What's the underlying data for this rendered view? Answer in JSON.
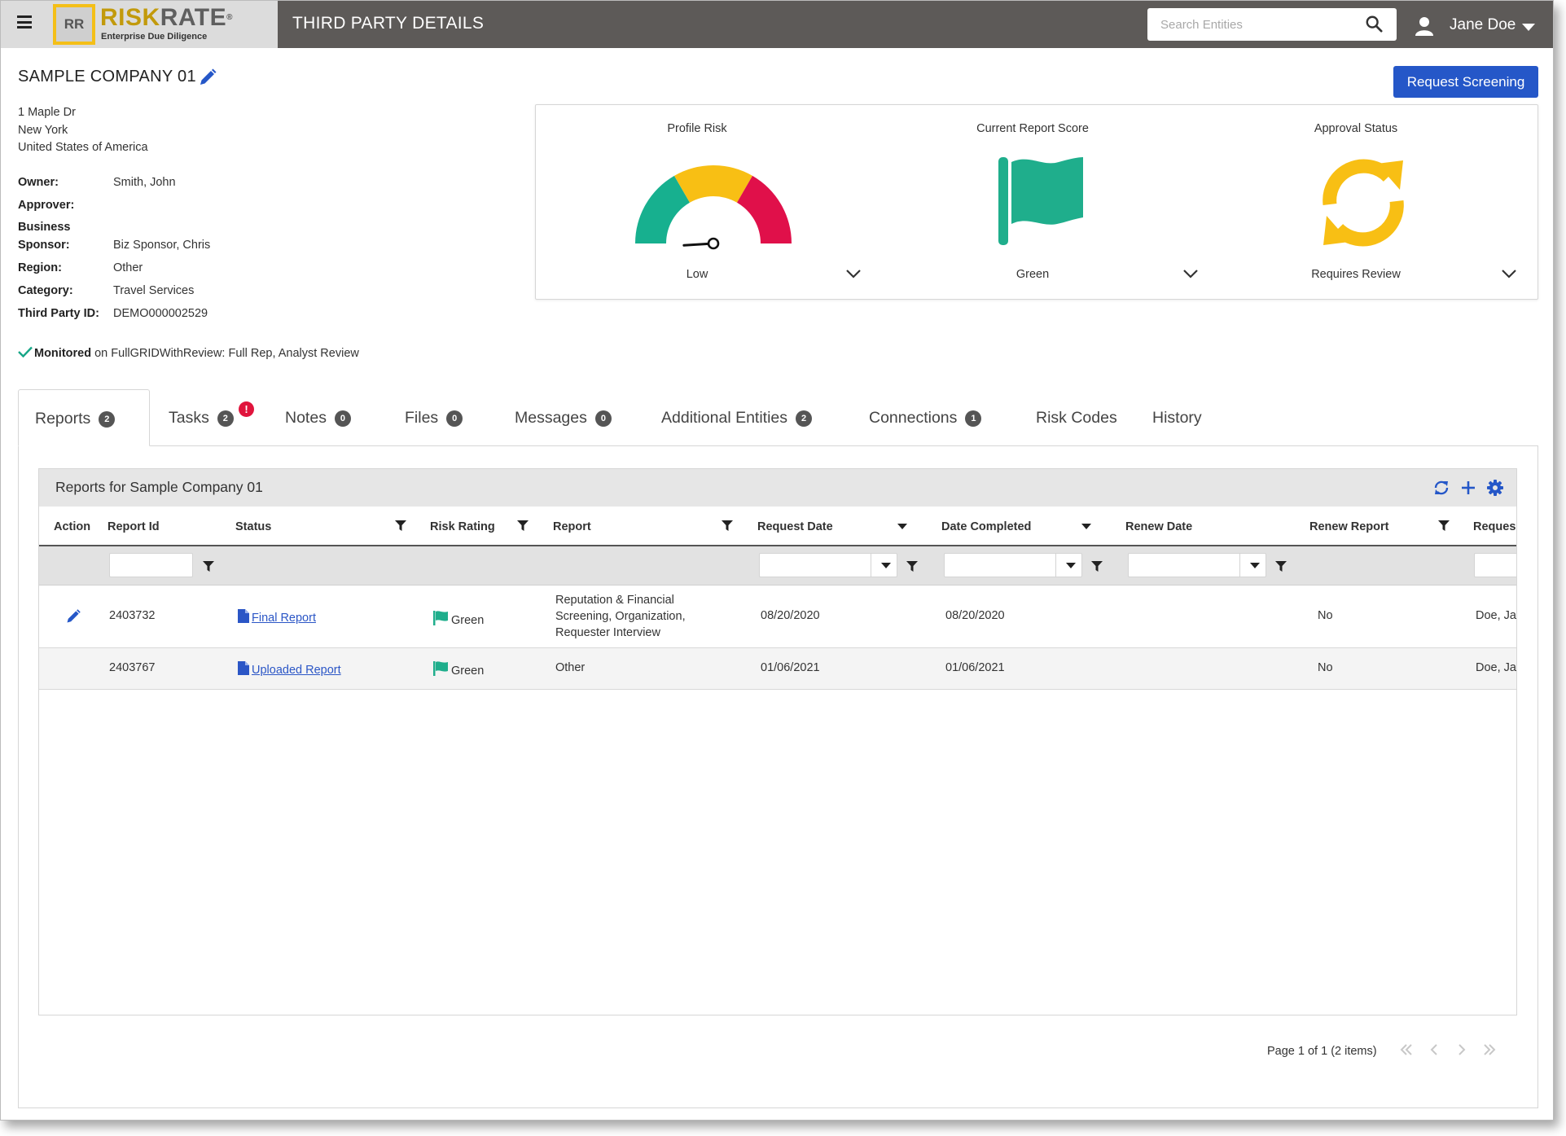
{
  "header": {
    "logo_box": "RR",
    "logo_risk": "RISK",
    "logo_rate": "RATE",
    "logo_reg": "®",
    "logo_tagline": "Enterprise Due Diligence",
    "page_title": "THIRD PARTY DETAILS",
    "search_placeholder": "Search Entities",
    "user_name": "Jane Doe"
  },
  "company": {
    "name": "SAMPLE COMPANY 01",
    "address_line1": "1 Maple Dr",
    "address_line2": "New York",
    "address_line3": "United States of America",
    "fields": {
      "owner_label": "Owner:",
      "owner_value": "Smith, John",
      "approver_label": "Approver:",
      "approver_value": "",
      "sponsor_label_1": "Business",
      "sponsor_label_2": "Sponsor:",
      "sponsor_value": "Biz Sponsor, Chris",
      "region_label": "Region:",
      "region_value": "Other",
      "category_label": "Category:",
      "category_value": "Travel Services",
      "tpid_label": "Third Party ID:",
      "tpid_value": "DEMO000002529"
    },
    "monitored_label": "Monitored",
    "monitored_text": "on FullGRIDWithReview: Full Rep, Analyst Review"
  },
  "request_button": "Request Screening",
  "scores": {
    "profile_risk": {
      "title": "Profile Risk",
      "value": "Low",
      "gauge_level": 0.1
    },
    "report_score": {
      "title": "Current Report Score",
      "value": "Green"
    },
    "approval": {
      "title": "Approval Status",
      "value": "Requires Review"
    }
  },
  "colors": {
    "accent_blue": "#2557c8",
    "gauge_green": "#17b08f",
    "gauge_yellow": "#f8bf14",
    "gauge_red": "#e0104a",
    "flag_green": "#1fae8c",
    "sync_yellow": "#f8bf14",
    "badge_red": "#e0143c"
  },
  "tabs": [
    {
      "label": "Reports",
      "count": "2"
    },
    {
      "label": "Tasks",
      "count": "2",
      "alert": "!"
    },
    {
      "label": "Notes",
      "count": "0"
    },
    {
      "label": "Files",
      "count": "0"
    },
    {
      "label": "Messages",
      "count": "0"
    },
    {
      "label": "Additional Entities",
      "count": "2"
    },
    {
      "label": "Connections",
      "count": "1"
    },
    {
      "label": "Risk Codes"
    },
    {
      "label": "History"
    }
  ],
  "grid": {
    "title": "Reports for Sample Company 01",
    "columns": [
      "Action",
      "Report Id",
      "Status",
      "Risk Rating",
      "Report",
      "Request Date",
      "Date Completed",
      "Renew Date",
      "Renew Report",
      "Reques"
    ],
    "rows": [
      {
        "report_id": "2403732",
        "status": "Final Report",
        "risk": "Green",
        "report": "Reputation & Financial Screening, Organization, Requester Interview",
        "request_date": "08/20/2020",
        "date_completed": "08/20/2020",
        "renew_date": "",
        "renew_report": "No",
        "requester": "Doe, Ja"
      },
      {
        "report_id": "2403767",
        "status": "Uploaded Report",
        "risk": "Green",
        "report": "Other",
        "request_date": "01/06/2021",
        "date_completed": "01/06/2021",
        "renew_date": "",
        "renew_report": "No",
        "requester": "Doe, Ja"
      }
    ],
    "pager_text": "Page 1 of 1 (2 items)"
  }
}
